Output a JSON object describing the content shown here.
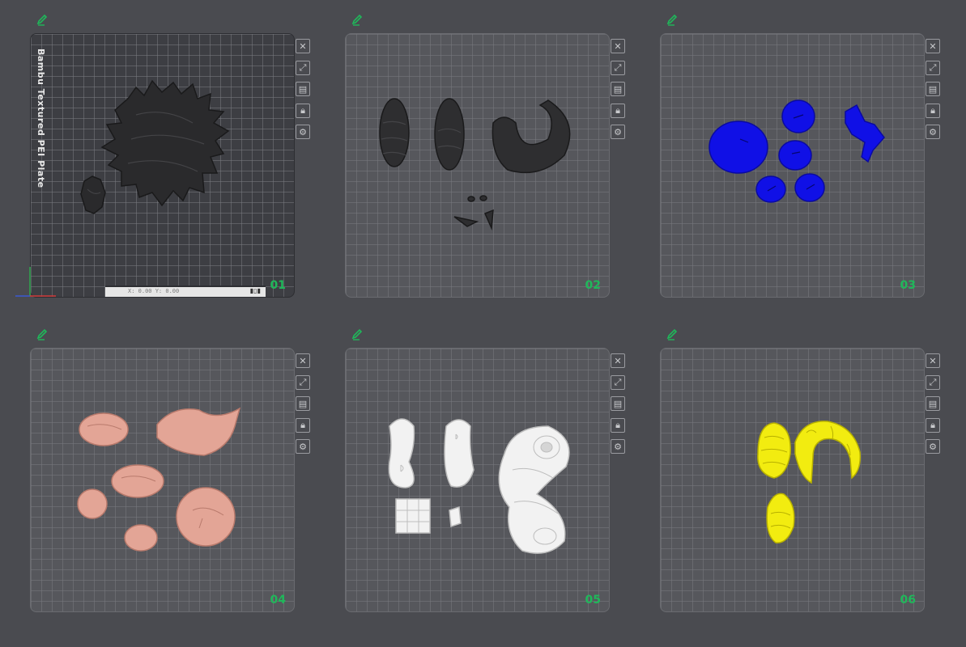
{
  "plates": [
    {
      "number": "01",
      "selected": true,
      "plate_name": "Bambu Textured PEI Plate",
      "bottom_bar_text": "X: 0.00  Y: 0.00",
      "color": "#2a2a2c"
    },
    {
      "number": "02",
      "selected": false,
      "color": "#2e2e30"
    },
    {
      "number": "03",
      "selected": false,
      "color": "#1010e6"
    },
    {
      "number": "04",
      "selected": false,
      "color": "#e3a596"
    },
    {
      "number": "05",
      "selected": false,
      "color": "#f2f2f2"
    },
    {
      "number": "06",
      "selected": false,
      "color": "#f2ec10"
    }
  ],
  "plate_tools": [
    "close-icon",
    "auto-arrange-icon",
    "orient-icon",
    "lock-icon",
    "settings-icon"
  ],
  "colors": {
    "accent": "#1fb85a",
    "background": "#4a4b50"
  }
}
